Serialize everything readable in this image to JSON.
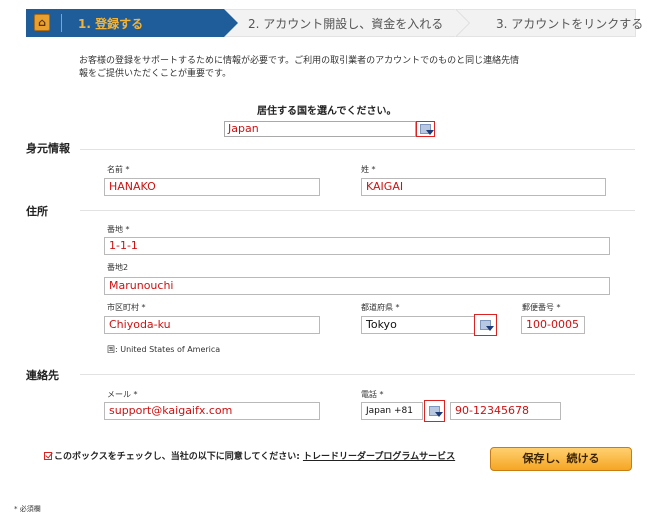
{
  "steps": [
    {
      "label": "1. 登録する",
      "active": true
    },
    {
      "label": "2. アカウント開設し、資金を入れる",
      "active": false
    },
    {
      "label": "3. アカウントをリンクする",
      "active": false
    }
  ],
  "intro_line1": "お客様の登録をサポートするために情報が必要です。ご利用の取引業者のアカウントでのものと同じ連絡先情",
  "intro_line2": "報をご提供いただくことが重要です。",
  "country": {
    "label": "居住する国を選んでください。",
    "value": "Japan"
  },
  "identity": {
    "title": "身元情報",
    "first_name_label": "名前 *",
    "first_name_value": "HANAKO",
    "last_name_label": "姓 *",
    "last_name_value": "KAIGAI"
  },
  "address": {
    "title": "住所",
    "street1_label": "番地 *",
    "street1_value": "1-1-1",
    "street2_label": "番地2",
    "street2_value": "Marunouchi",
    "city_label": "市区町村 *",
    "city_value": "Chiyoda-ku",
    "prefecture_label": "都道府県 *",
    "prefecture_value": "Tokyo",
    "postal_label": "郵便番号 *",
    "postal_value": "100-0005",
    "country_note": "国:  United States of America"
  },
  "contact": {
    "title": "連絡先",
    "email_label": "メール *",
    "email_value": "support@kaigaifx.com",
    "phone_label": "電話 *",
    "phone_code": "Japan +81",
    "phone_value": "90-12345678"
  },
  "agreement": {
    "text": "このボックスをチェックし、当社の以下に同意してください: ",
    "link": "トレードリーダープログラムサービス"
  },
  "save_button": "保存し、続ける",
  "required_note": "* 必須欄",
  "colors": {
    "step_active_bg": "#1f5c9a",
    "step_active_text": "#f5b335",
    "button": "#f5a623",
    "highlight": "#d01010"
  }
}
